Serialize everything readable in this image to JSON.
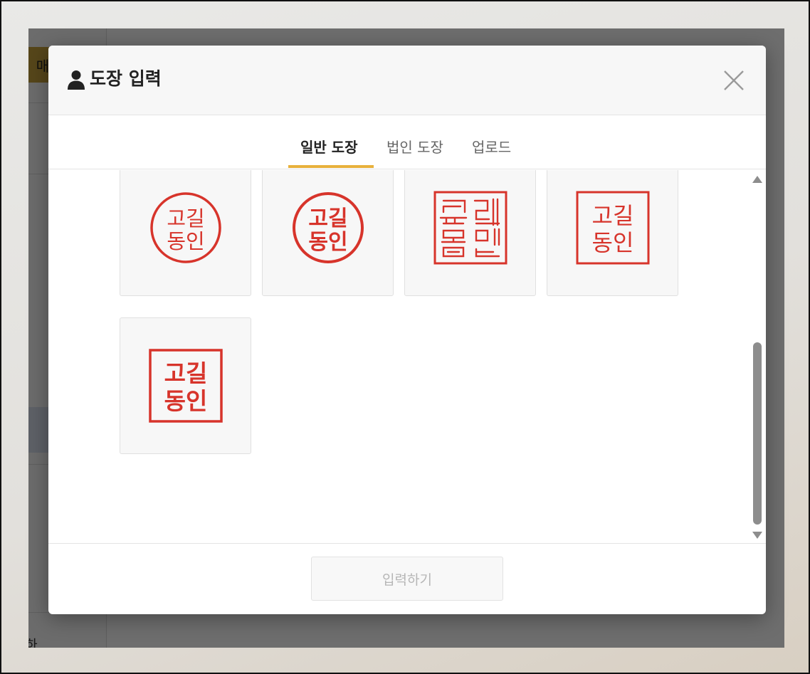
{
  "background": {
    "side_button_label": "매",
    "bottom_text": "하"
  },
  "modal": {
    "title": "도장 입력",
    "tabs": [
      {
        "label": "일반 도장",
        "active": true
      },
      {
        "label": "법인 도장",
        "active": false
      },
      {
        "label": "업로드",
        "active": false
      }
    ],
    "submit_label": "입력하기"
  },
  "stamps": [
    {
      "style": "circle-thin",
      "lines": [
        "고길",
        "동인"
      ]
    },
    {
      "style": "circle-bold",
      "lines": [
        "고길",
        "동인"
      ]
    },
    {
      "style": "square-seal-script",
      "lines": [
        "고길",
        "동인"
      ]
    },
    {
      "style": "square-thin",
      "lines": [
        "고길",
        "동인"
      ]
    },
    {
      "style": "square-bold",
      "lines": [
        "고길",
        "동인"
      ]
    }
  ],
  "colors": {
    "stamp_red": "#d7342b",
    "accent": "#e8b13c",
    "overlay": "rgba(0,0,0,0.57)"
  },
  "icons": [
    "person-icon",
    "close-icon",
    "scroll-up-arrow-icon",
    "scroll-down-arrow-icon"
  ]
}
